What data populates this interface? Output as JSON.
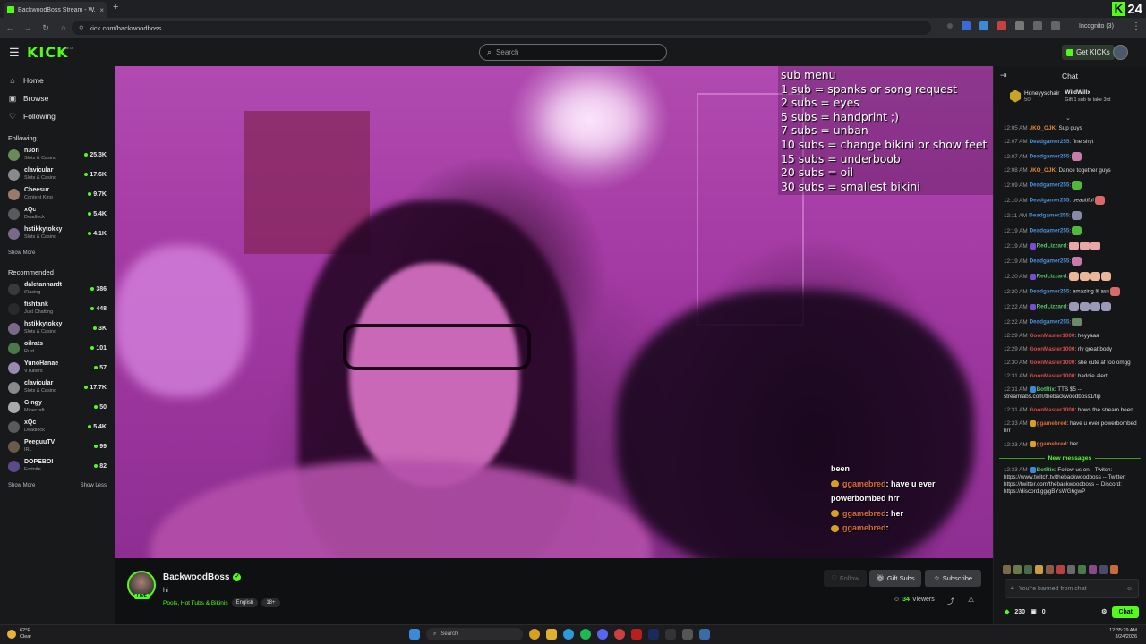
{
  "browser": {
    "tab_title": "BackwoodBoss Stream - W...",
    "tab_close": "×",
    "new_tab": "+",
    "url": "kick.com/backwoodboss",
    "incognito": "Incognito (3)",
    "corner_logo_letter": "K",
    "corner_logo_number": "24"
  },
  "header": {
    "logo": "KICK",
    "logo_beta": "BETA",
    "search_placeholder": "Search",
    "get_kicks": "Get KICKs"
  },
  "sidebar": {
    "nav": [
      {
        "label": "Home",
        "icon": "home-icon"
      },
      {
        "label": "Browse",
        "icon": "browse-icon"
      },
      {
        "label": "Following",
        "icon": "heart-icon"
      }
    ],
    "following_title": "Following",
    "following": [
      {
        "name": "n3on",
        "category": "Slots & Casino",
        "viewers": "25.3K",
        "color": "#6a8a5a"
      },
      {
        "name": "clavicular",
        "category": "Slots & Casino",
        "viewers": "17.6K",
        "color": "#8a8a8a"
      },
      {
        "name": "Cheesur",
        "category": "Content King",
        "viewers": "9.7K",
        "color": "#9a7a6a"
      },
      {
        "name": "xQc",
        "category": "Deadlock",
        "viewers": "5.4K",
        "color": "#5a5a5a"
      },
      {
        "name": "hstikkytokky",
        "category": "Slots & Casino",
        "viewers": "4.1K",
        "color": "#7a6a8a"
      }
    ],
    "show_more_1": "Show More",
    "recommended_title": "Recommended",
    "recommended": [
      {
        "name": "daletanhardt",
        "category": "iRacing",
        "viewers": "386",
        "color": "#3a3a3a"
      },
      {
        "name": "fishtank",
        "category": "Just Chatting",
        "viewers": "448",
        "color": "#2a2a2a"
      },
      {
        "name": "hstikkytokky",
        "category": "Slots & Casino",
        "viewers": "3K",
        "color": "#7a6a8a"
      },
      {
        "name": "oilrats",
        "category": "Rust",
        "viewers": "101",
        "color": "#4a7a4a"
      },
      {
        "name": "YunoHanae",
        "category": "VTubers",
        "viewers": "57",
        "color": "#9a8ab0"
      },
      {
        "name": "clavicular",
        "category": "Slots & Casino",
        "viewers": "17.7K",
        "color": "#8a8a8a"
      },
      {
        "name": "Gingy",
        "category": "Minecraft",
        "viewers": "50",
        "color": "#aaaaaa"
      },
      {
        "name": "xQc",
        "category": "Deadlock",
        "viewers": "5.4K",
        "color": "#5a5a5a"
      },
      {
        "name": "PeeguuTV",
        "category": "IRL",
        "viewers": "99",
        "color": "#6a5a4a"
      },
      {
        "name": "DOPEBOI",
        "category": "Fortnite",
        "viewers": "82",
        "color": "#5a4a8a"
      }
    ],
    "show_more_2": "Show More",
    "show_less": "Show Less"
  },
  "video": {
    "sub_menu": [
      "sub menu",
      "1 sub = spanks or song request",
      "2 subs = eyes",
      "5 subs = handprint ;)",
      "7 subs = unban",
      "10 subs = change bikini or show feet",
      "15 subs = underboob",
      "20 subs = oil",
      "30 subs = smallest bikini"
    ],
    "overlay_chat": {
      "line1": "been",
      "line2_user": "ggamebred",
      "line2_text": ": have u ever",
      "line3": "powerbombed hrr",
      "line4_user": "ggamebred",
      "line4_text": ": her",
      "line5_user": "ggamebred",
      "line5_text": ":"
    }
  },
  "stream": {
    "streamer": "BackwoodBoss",
    "live_badge": "LIVE",
    "title": "hi",
    "category": "Pools, Hot Tubs & Bikinis",
    "tags": [
      "English",
      "18+"
    ],
    "follow": "Follow",
    "gift_subs": "Gift Subs",
    "subscribe": "Subscribe",
    "viewers_count": "34",
    "viewers_label": "Viewers"
  },
  "chat": {
    "title": "Chat",
    "pinned_user": "Honeyyschair",
    "pinned_count": "50",
    "gift_user": "WildWillx",
    "gift_text": "Gift 1 sub to take 3rd",
    "messages": [
      {
        "time": "12:05 AM",
        "user": "JKO_OJK",
        "color": "#e08a3a",
        "text": ": Sup guys",
        "emotes": []
      },
      {
        "time": "12:07 AM",
        "user": "Deadgamer255",
        "color": "#4a90d9",
        "text": ": fine shyt",
        "emotes": []
      },
      {
        "time": "12:07 AM",
        "user": "Deadgamer255",
        "color": "#4a90d9",
        "text": ":",
        "emotes": [
          "#c87aa8"
        ]
      },
      {
        "time": "12:08 AM",
        "user": "JKO_OJK",
        "color": "#e08a3a",
        "text": ": Dance together guys",
        "emotes": []
      },
      {
        "time": "12:09 AM",
        "user": "Deadgamer255",
        "color": "#4a90d9",
        "text": ":",
        "emotes": [
          "#53b83a"
        ]
      },
      {
        "time": "12:10 AM",
        "user": "Deadgamer255",
        "color": "#4a90d9",
        "text": ": beautiful",
        "emotes": [
          "#d86a6a"
        ]
      },
      {
        "time": "12:11 AM",
        "user": "Deadgamer255",
        "color": "#4a90d9",
        "text": ":",
        "emotes": [
          "#8a8aa8"
        ]
      },
      {
        "time": "12:19 AM",
        "user": "Deadgamer255",
        "color": "#4a90d9",
        "text": ":",
        "emotes": [
          "#53b83a"
        ]
      },
      {
        "time": "12:19 AM",
        "user": "RedLizzard",
        "color": "#53c86a",
        "text": ":",
        "emotes": [
          "#e8a8a8",
          "#e8a8a8",
          "#e8a8a8"
        ],
        "badge": "#7a4ad8"
      },
      {
        "time": "12:19 AM",
        "user": "Deadgamer255",
        "color": "#4a90d9",
        "text": ":",
        "emotes": [
          "#c87aa8"
        ]
      },
      {
        "time": "12:20 AM",
        "user": "RedLizzard",
        "color": "#53c86a",
        "text": ":",
        "emotes": [
          "#e8b898",
          "#e8b898",
          "#e8b898",
          "#e8b898"
        ],
        "badge": "#7a4ad8"
      },
      {
        "time": "12:20 AM",
        "user": "Deadgamer255",
        "color": "#4a90d9",
        "text": ": amazing lil ass",
        "emotes": [
          "#d86a6a"
        ]
      },
      {
        "time": "12:22 AM",
        "user": "RedLizzard",
        "color": "#53c86a",
        "text": ":",
        "emotes": [
          "#9a9ab8",
          "#9a9ab8",
          "#9a9ab8",
          "#9a9ab8"
        ],
        "badge": "#7a4ad8"
      },
      {
        "time": "12:22 AM",
        "user": "Deadgamer255",
        "color": "#4a90d9",
        "text": ":",
        "emotes": [
          "#6a8a6a"
        ]
      },
      {
        "time": "12:29 AM",
        "user": "GoonMaster1000",
        "color": "#d84a4a",
        "text": ": heyyaaa",
        "emotes": []
      },
      {
        "time": "12:29 AM",
        "user": "GoonMaster1000",
        "color": "#d84a4a",
        "text": ": rly great body",
        "emotes": []
      },
      {
        "time": "12:30 AM",
        "user": "GoonMaster1000",
        "color": "#d84a4a",
        "text": ": she cute af too omgg",
        "emotes": []
      },
      {
        "time": "12:31 AM",
        "user": "GoonMaster1000",
        "color": "#d84a4a",
        "text": ": baddie alert!",
        "emotes": []
      },
      {
        "time": "12:31 AM",
        "user": "BotRix",
        "color": "#53c86a",
        "text": ": TTS $5 -- streamlabs.com/thebackwoodboss1/tip",
        "emotes": [],
        "badge": "#3a8ad8"
      },
      {
        "time": "12:31 AM",
        "user": "GoonMaster1000",
        "color": "#d84a4a",
        "text": ": hows the stream been",
        "emotes": []
      },
      {
        "time": "12:33 AM",
        "user": "ggamebred",
        "color": "#d86a3a",
        "text": ": have u ever powerbombed hrr",
        "emotes": [],
        "badge": "#d8a020"
      },
      {
        "time": "12:33 AM",
        "user": "ggamebred",
        "color": "#d86a3a",
        "text": ": her",
        "emotes": [],
        "badge": "#d8a020"
      }
    ],
    "new_messages": "New messages",
    "new_msg": {
      "time": "12:33 AM",
      "user": "BotRix",
      "color": "#53c86a",
      "text": ": Follow us on --Twitch: https://www.twitch.tv/thebackwoodboss -- Twitter: https://twitter.com/thebackwoodboss -- Discord: https://discord.gg/gBYsWG6gwP"
    },
    "input_placeholder": "You're banned from chat",
    "kicks_count": "230",
    "gift_count": "0",
    "send": "Chat"
  },
  "taskbar": {
    "temp": "62°F",
    "weather": "Clear",
    "search": "Search",
    "time": "12:35:29 AM",
    "date": "3/24/2026"
  }
}
